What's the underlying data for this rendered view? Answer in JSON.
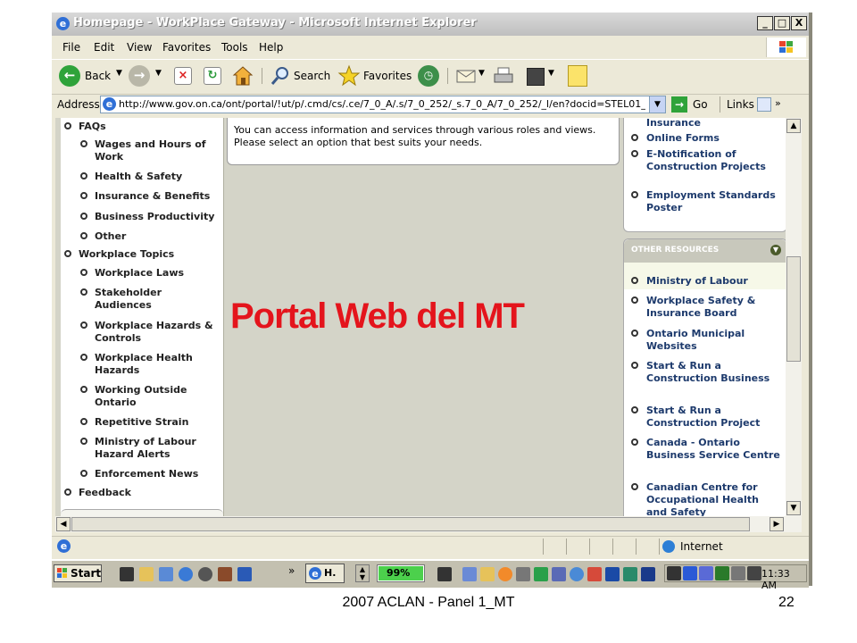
{
  "window": {
    "title": "Homepage - WorkPlace Gateway - Microsoft Internet Explorer",
    "controls": {
      "minimize": "_",
      "maximize": "□",
      "close": "X"
    }
  },
  "menu": [
    "File",
    "Edit",
    "View",
    "Favorites",
    "Tools",
    "Help"
  ],
  "toolbar": {
    "back_label": "Back",
    "search_label": "Search",
    "favorites_label": "Favorites"
  },
  "address": {
    "label": "Address",
    "url": "http://www.gov.on.ca/ont/portal/!ut/p/.cmd/cs/.ce/7_0_A/.s/7_0_252/_s.7_0_A/7_0_252/_l/en?docid=STEL01_03",
    "go_label": "Go",
    "links_label": "Links",
    "more_glyph": "»"
  },
  "left_nav": {
    "items": [
      {
        "label": "FAQs",
        "level": 0
      },
      {
        "label": "Wages and Hours of Work",
        "level": 1
      },
      {
        "label": "Health & Safety",
        "level": 1
      },
      {
        "label": "Insurance & Benefits",
        "level": 1
      },
      {
        "label": "Business Productivity",
        "level": 1
      },
      {
        "label": "Other",
        "level": 1
      },
      {
        "label": "Workplace Topics",
        "level": 0
      },
      {
        "label": "Workplace Laws",
        "level": 1
      },
      {
        "label": "Stakeholder Audiences",
        "level": 1
      },
      {
        "label": "Workplace Hazards & Controls",
        "level": 1
      },
      {
        "label": "Workplace Health Hazards",
        "level": 1
      },
      {
        "label": "Working Outside Ontario",
        "level": 1
      },
      {
        "label": "Repetitive Strain",
        "level": 1
      },
      {
        "label": "Ministry of Labour Hazard Alerts",
        "level": 1
      },
      {
        "label": "Enforcement News",
        "level": 1
      },
      {
        "label": "Feedback",
        "level": 0
      }
    ]
  },
  "center": {
    "intro": "You can access information and services through various roles and views. Please select an option that best suits your needs."
  },
  "overlay_title": "Portal Web del MT",
  "right_top": {
    "partial_label": "Insurance",
    "items": [
      "Online Forms",
      "E-Notification of Construction Projects",
      "Employment Standards Poster"
    ]
  },
  "other_resources": {
    "header": "OTHER RESOURCES",
    "items": [
      "Ministry of Labour",
      "Workplace Safety & Insurance Board",
      "Ontario Municipal Websites",
      "Start & Run a Construction Business",
      "Start & Run a Construction Project",
      "Canada - Ontario Business Service Centre",
      "Canadian Centre for Occupational Health and Safety"
    ]
  },
  "status": {
    "zone": "Internet"
  },
  "taskbar": {
    "start_label": "Start",
    "task_label": "H.",
    "battery": "99%",
    "more_glyph": "»",
    "clock": "11:33 AM"
  },
  "footer": {
    "caption": "2007 ACLAN - Panel 1_MT",
    "page_number": "22"
  },
  "colors": {
    "overlay_title": "#e4141c",
    "link_text": "#1d3a6c"
  }
}
